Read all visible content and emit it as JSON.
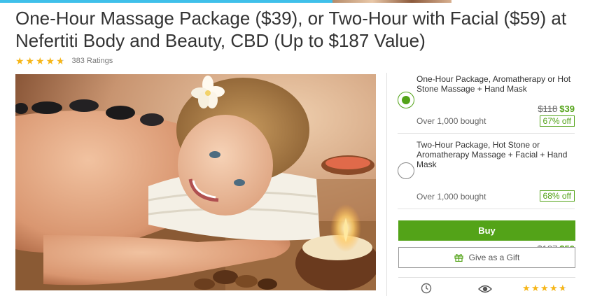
{
  "header": {
    "title": "One-Hour Massage Package ($39), or Two-Hour with Facial ($59) at Nefertiti Body and Beauty, CBD (Up to $187 Value)"
  },
  "rating": {
    "stars": 4.6,
    "count_text": "383 Ratings",
    "star_color": "#f6b619"
  },
  "photo": {
    "icon": "deal-photo"
  },
  "options": [
    {
      "title": "One-Hour Package, Aromatherapy or Hot Stone Massage + Hand Mask",
      "selected": true,
      "old_price": "$118",
      "new_price": "$39",
      "bought": "Over 1,000 bought",
      "discount": "67% off"
    },
    {
      "title": "Two-Hour Package, Hot Stone or Aromatherapy Massage + Facial + Hand Mask",
      "selected": false,
      "old_price": "$187",
      "new_price": "$59",
      "bought": "Over 1,000 bought",
      "discount": "68% off"
    }
  ],
  "actions": {
    "buy_label": "Buy",
    "gift_label": "Give as a Gift"
  },
  "footer": {
    "icons": [
      "clock-icon",
      "eye-icon",
      "rating-stars"
    ]
  },
  "colors": {
    "accent_green": "#53a318",
    "top_bar_blue": "#3fc0ea"
  }
}
